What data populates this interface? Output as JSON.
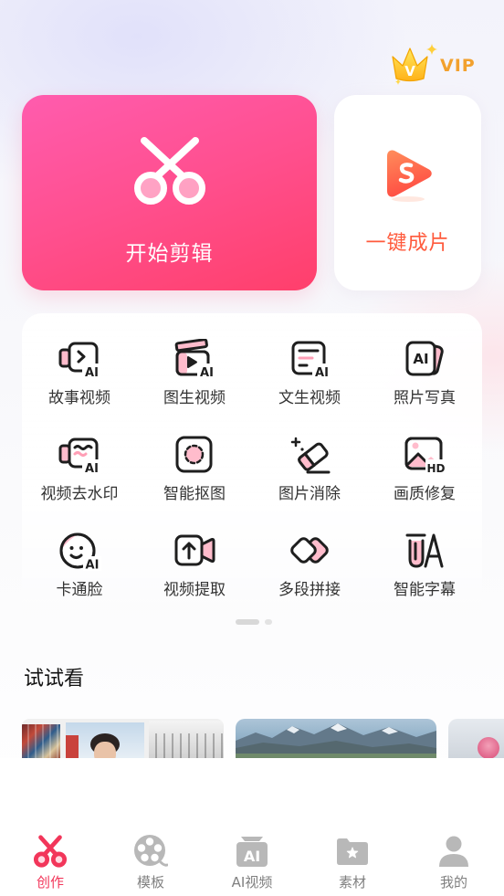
{
  "vip": {
    "crown_letter": "V",
    "label": "VIP",
    "icon": "crown-icon"
  },
  "hero": {
    "start_edit": {
      "label": "开始剪辑",
      "icon": "scissors-icon"
    },
    "one_click": {
      "label": "一键成片",
      "icon": "one-click-play-icon"
    }
  },
  "icon_text": {
    "ai": "AI",
    "hd": "HD"
  },
  "tools": [
    {
      "label": "故事视频",
      "icon": "story-video-icon"
    },
    {
      "label": "图生视频",
      "icon": "image-to-video-icon"
    },
    {
      "label": "文生视频",
      "icon": "text-to-video-icon"
    },
    {
      "label": "照片写真",
      "icon": "photo-portrait-icon"
    },
    {
      "label": "视频去水印",
      "icon": "video-watermark-remove-icon"
    },
    {
      "label": "智能抠图",
      "icon": "smart-cutout-icon"
    },
    {
      "label": "图片消除",
      "icon": "image-eraser-icon"
    },
    {
      "label": "画质修复",
      "icon": "quality-restore-icon"
    },
    {
      "label": "卡通脸",
      "icon": "cartoon-face-icon"
    },
    {
      "label": "视频提取",
      "icon": "video-extract-icon"
    },
    {
      "label": "多段拼接",
      "icon": "multi-clip-join-icon"
    },
    {
      "label": "智能字幕",
      "icon": "smart-subtitle-icon"
    }
  ],
  "pager": {
    "pages": 2,
    "active": 1
  },
  "try_section": {
    "title": "试试看"
  },
  "tabs": [
    {
      "label": "创作",
      "icon": "scissors-icon",
      "active": true
    },
    {
      "label": "模板",
      "icon": "film-reel-icon",
      "active": false
    },
    {
      "label": "AI视频",
      "icon": "ai-video-icon",
      "active": false
    },
    {
      "label": "素材",
      "icon": "folder-star-icon",
      "active": false
    },
    {
      "label": "我的",
      "icon": "person-icon",
      "active": false
    }
  ],
  "colors": {
    "accent": "#f2365a",
    "start_edit_gradient_top": "#ff5cae",
    "start_edit_gradient_bottom": "#ff3f6b",
    "one_click_text": "#ff5a3c",
    "vip_gold": "#f2a12e",
    "tab_inactive_icon": "#b8b8b8",
    "tab_inactive_label": "#808080",
    "tool_accent_pink": "#ffbccc"
  }
}
